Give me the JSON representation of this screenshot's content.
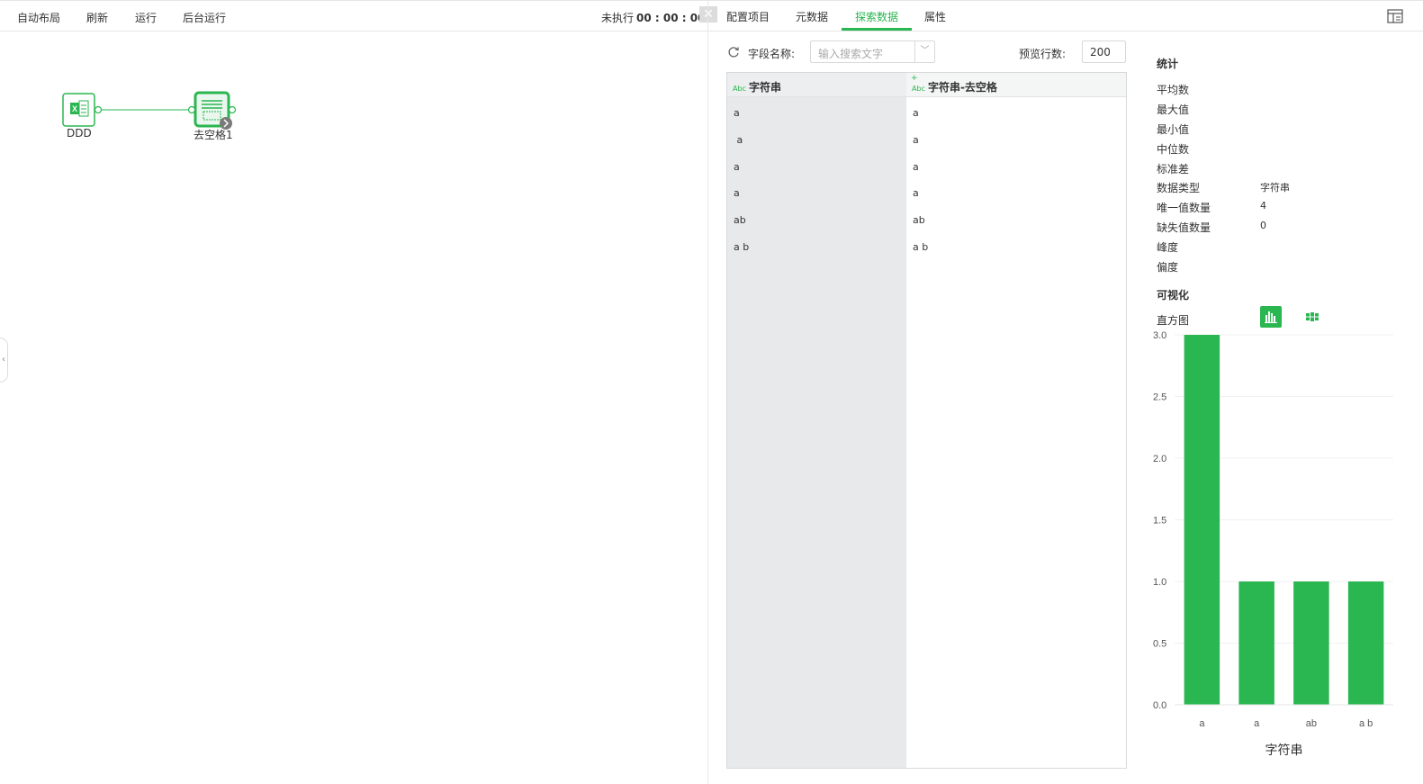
{
  "toolbar": {
    "auto_layout": "自动布局",
    "refresh": "刷新",
    "run": "运行",
    "background_run": "后台运行",
    "status_label": "未执行",
    "status_time": "00 : 00 : 00"
  },
  "canvas": {
    "nodes": [
      {
        "label": "DDD",
        "icon": "excel-icon"
      },
      {
        "label": "去空格1",
        "icon": "trim-icon"
      }
    ]
  },
  "tabs": {
    "config": "配置项目",
    "metadata": "元数据",
    "explore": "探索数据",
    "properties": "属性",
    "active": "探索数据"
  },
  "search": {
    "field_label": "字段名称:",
    "placeholder": "输入搜索文字",
    "rows_label": "预览行数:",
    "rows_value": "200"
  },
  "table": {
    "type_badge": "Abc",
    "new_marker": "+",
    "columns": [
      "字符串",
      "字符串-去空格"
    ],
    "rows": [
      [
        "a",
        "a"
      ],
      [
        " a",
        "a"
      ],
      [
        "a",
        "a"
      ],
      [
        "a",
        "a"
      ],
      [
        "ab",
        "ab"
      ],
      [
        "a b",
        "a b"
      ]
    ]
  },
  "stats": {
    "title": "统计",
    "items": [
      {
        "name": "平均数",
        "value": ""
      },
      {
        "name": "最大值",
        "value": ""
      },
      {
        "name": "最小值",
        "value": ""
      },
      {
        "name": "中位数",
        "value": ""
      },
      {
        "name": "标准差",
        "value": ""
      },
      {
        "name": "数据类型",
        "value": "字符串"
      },
      {
        "name": "唯一值数量",
        "value": "4"
      },
      {
        "name": "缺失值数量",
        "value": "0"
      },
      {
        "name": "峰度",
        "value": ""
      },
      {
        "name": "偏度",
        "value": ""
      }
    ]
  },
  "visual": {
    "title": "可视化",
    "histogram_label": "直方图"
  },
  "colors": {
    "accent": "#2ab650"
  },
  "chart_data": {
    "type": "bar",
    "categories": [
      "a",
      "a",
      "ab",
      "a b"
    ],
    "values": [
      3,
      1,
      1,
      1
    ],
    "xlabel": "字符串",
    "ylabel": "",
    "ylim": [
      0,
      3
    ],
    "yticks": [
      "0.0",
      "0.5",
      "1.0",
      "1.5",
      "2.0",
      "2.5",
      "3.0"
    ],
    "grid": true,
    "color": "#2ab650"
  }
}
